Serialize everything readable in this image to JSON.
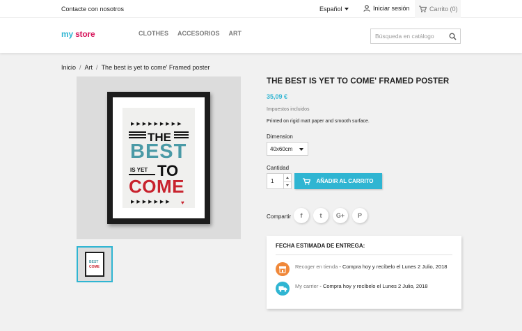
{
  "topbar": {
    "contact": "Contacte con nosotros",
    "language": "Español",
    "login": "Iniciar sesión",
    "cart": "Carrito (0)"
  },
  "header": {
    "logo_part1": "my",
    "logo_part2": " store",
    "nav": [
      "CLOTHES",
      "ACCESORIOS",
      "ART"
    ],
    "search_placeholder": "Búsqueda en catálogo"
  },
  "breadcrumb": [
    "Inicio",
    "Art",
    "The best is yet to come' Framed poster"
  ],
  "poster": {
    "the": "THE",
    "best": "BEST",
    "is_yet": "IS YET",
    "to": "TO",
    "come": "COME"
  },
  "product": {
    "title": "THE BEST IS YET TO COME' FRAMED POSTER",
    "price": "35,09 €",
    "tax": "Impuestos incluidos",
    "description": "Printed on rigid matt paper and smooth surface.",
    "dimension_label": "Dimension",
    "dimension_value": "40x60cm",
    "quantity_label": "Cantidad",
    "quantity_value": "1",
    "add_to_cart": "AÑADIR AL CARRITO",
    "share_label": "Compartir",
    "share_buttons": [
      "f",
      "t",
      "G+",
      "P"
    ]
  },
  "delivery": {
    "title": "FECHA ESTIMADA DE ENTREGA:",
    "options": [
      {
        "name": "Recoger en tienda",
        "sep": " - ",
        "text": "Compra hoy y recíbelo el Lunes 2 Julio, 2018"
      },
      {
        "name": "My carrier",
        "sep": " - ",
        "text": "Compra hoy y recíbelo el Lunes 2 Julio, 2018"
      }
    ]
  },
  "colors": {
    "accent": "#2fb5d2",
    "poster_blue": "#4a9aa6",
    "poster_red": "#c8222d"
  }
}
